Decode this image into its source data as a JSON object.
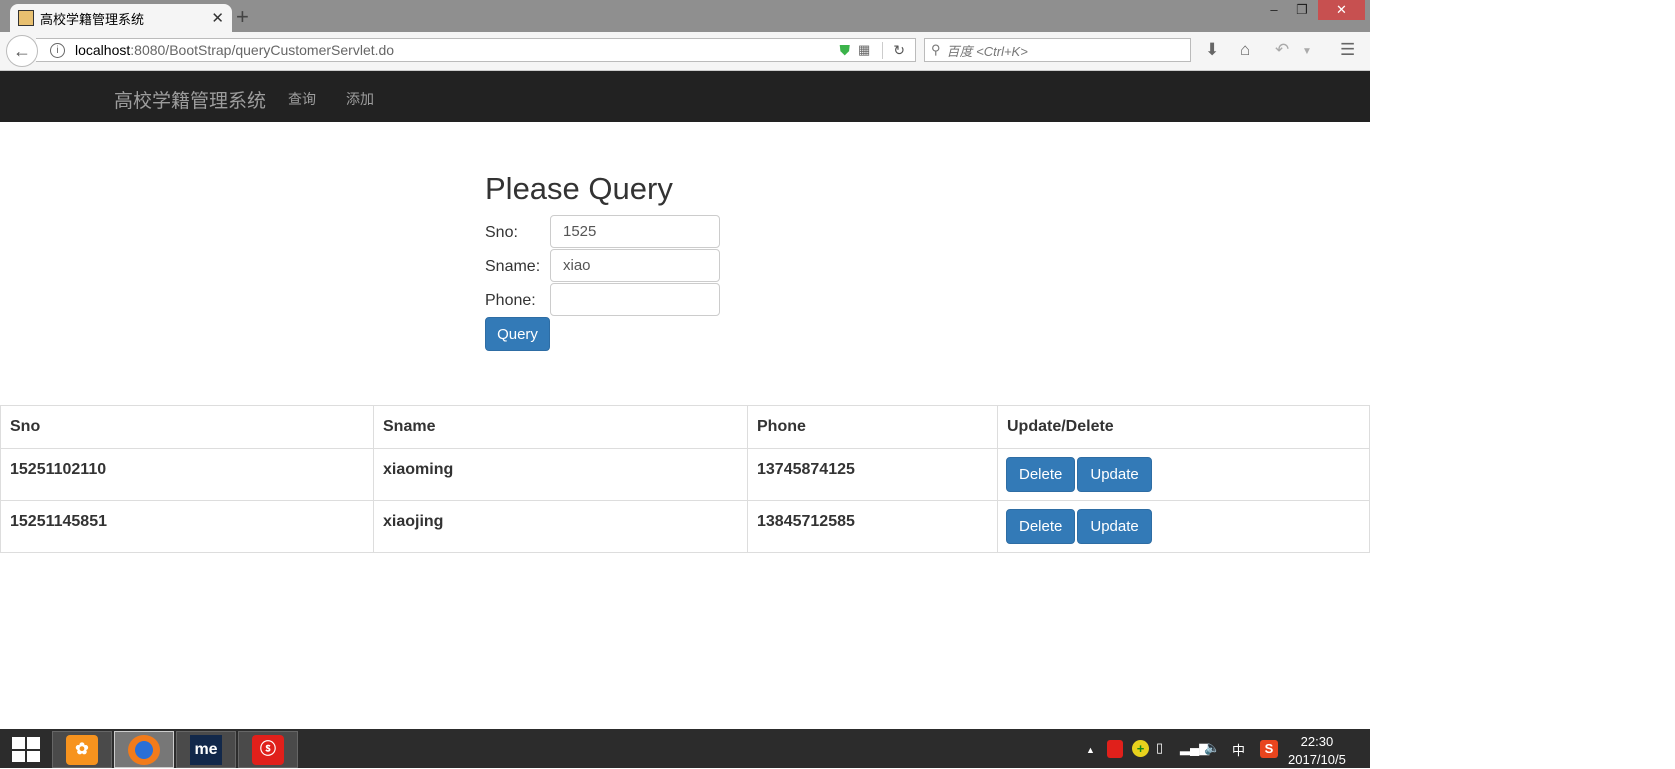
{
  "browser": {
    "tab_title": "高校学籍管理系统",
    "tab_close": "✕",
    "new_tab": "+",
    "url_host": "localhost",
    "url_rest": ":8080/BootStrap/queryCustomerServlet.do",
    "search_placeholder": "百度 <Ctrl+K>",
    "window_controls": {
      "minimize": "–",
      "restore": "❐",
      "close": "✕"
    }
  },
  "navbar": {
    "brand": "高校学籍管理系统",
    "links": [
      "查询",
      "添加"
    ]
  },
  "form": {
    "title": "Please Query",
    "fields": [
      {
        "label": "Sno:",
        "value": "1525"
      },
      {
        "label": "Sname:",
        "value": "xiao"
      },
      {
        "label": "Phone:",
        "value": ""
      }
    ],
    "submit": "Query"
  },
  "table": {
    "headers": [
      "Sno",
      "Sname",
      "Phone",
      "Update/Delete"
    ],
    "rows": [
      {
        "sno": "15251102110",
        "sname": "xiaoming",
        "phone": "13745874125"
      },
      {
        "sno": "15251145851",
        "sname": "xiaojing",
        "phone": "13845712585"
      }
    ],
    "delete_label": "Delete",
    "update_label": "Update"
  },
  "taskbar": {
    "apps": [
      "uc-browser",
      "firefox",
      "me",
      "netease-music"
    ],
    "me_label": "me",
    "ime": "中",
    "time": "22:30",
    "date": "2017/10/5"
  },
  "colors": {
    "primary": "#337ab7",
    "navbar": "#222222",
    "close": "#c75050"
  }
}
